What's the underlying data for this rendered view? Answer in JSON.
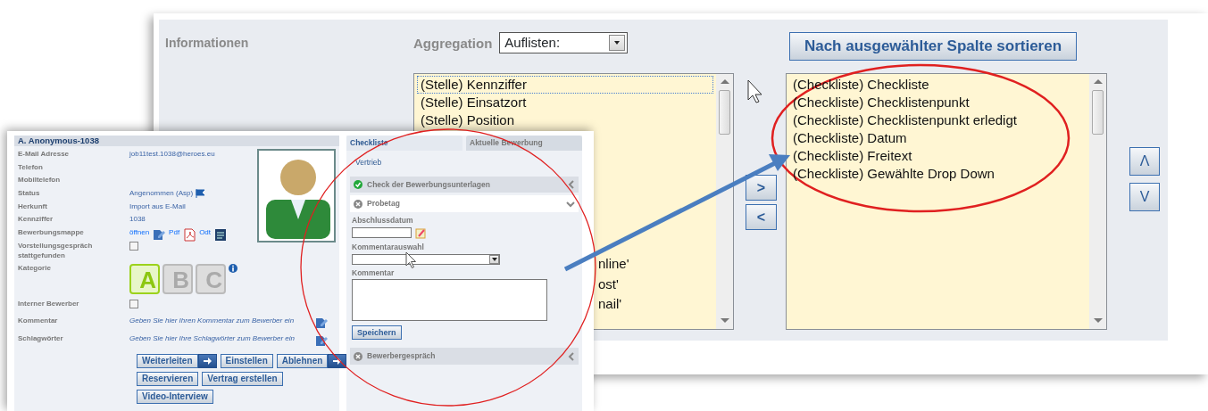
{
  "back_window": {
    "section_title": "Informationen",
    "aggregation": {
      "label": "Aggregation",
      "value": "Auflisten:"
    },
    "available_list": {
      "items": [
        {
          "text": "(Stelle) Kennziffer",
          "focused": true
        },
        {
          "text": "(Stelle) Einsatzort",
          "focused": false
        },
        {
          "text": "(Stelle) Position",
          "focused": false
        }
      ],
      "partial_items": [
        "nline'",
        "ost'",
        "nail'"
      ]
    },
    "move_buttons": [
      ">",
      "<"
    ],
    "sort_button": "Nach ausgewählter Spalte sortieren",
    "selected_list": {
      "items": [
        "(Checkliste) Checkliste",
        "(Checkliste) Checklistenpunkt",
        "(Checkliste) Checklistenpunkt erledigt",
        "(Checkliste) Datum",
        "(Checkliste) Freitext",
        "(Checkliste) Gewählte Drop Down"
      ]
    },
    "order_buttons": [
      "Λ",
      "V"
    ]
  },
  "front_window": {
    "candidate": {
      "name": "A. Anonymous-1038",
      "fields": [
        {
          "kind": "text",
          "label": "E-Mail Adresse",
          "value": "job11test.1038@heroes.eu"
        },
        {
          "kind": "text",
          "label": "Telefon"
        },
        {
          "kind": "text",
          "label": "Mobiltelefon"
        },
        {
          "kind": "status",
          "label": "Status",
          "value": "Angenommen (Asp)"
        },
        {
          "kind": "text",
          "label": "Herkunft",
          "value": "Import aus E-Mail"
        },
        {
          "kind": "text",
          "label": "Kennziffer",
          "value": "1038"
        },
        {
          "kind": "files",
          "label": "Bewerbungsmappe",
          "links": [
            {
              "kind": "open",
              "text": "öffnen"
            },
            {
              "kind": "pdf",
              "text": "Pdf"
            },
            {
              "kind": "odt",
              "text": "Odt"
            }
          ]
        },
        {
          "kind": "checkbox",
          "label": "Vorstellungsgespräch stattgefunden",
          "checked": false
        },
        {
          "kind": "category",
          "label": "Kategorie",
          "options": [
            {
              "letter": "A",
              "selected": true
            },
            {
              "letter": "B",
              "selected": false
            },
            {
              "letter": "C",
              "selected": false
            }
          ]
        },
        {
          "kind": "checkbox",
          "label": "Interner Bewerber",
          "checked": false
        },
        {
          "kind": "prompt",
          "label": "Kommentar",
          "value": "Geben Sie hier Ihren Kommentar zum Bewerber ein"
        },
        {
          "kind": "prompt",
          "label": "Schlagwörter",
          "value": "Geben Sie hier Ihre Schlagwörter zum Bewerber ein"
        }
      ],
      "button_rows": [
        [
          {
            "label": "Weiterleiten",
            "arrow": true
          },
          {
            "label": "Einstellen",
            "arrow": false
          },
          {
            "label": "Ablehnen",
            "arrow": true
          }
        ],
        [
          {
            "label": "Reservieren",
            "arrow": false
          },
          {
            "label": "Vertrag erstellen",
            "arrow": false
          }
        ],
        [
          {
            "label": "Video-Interview",
            "arrow": false
          }
        ]
      ]
    },
    "checklist": {
      "tabs": [
        {
          "label": "Checkliste",
          "selected": true
        },
        {
          "label": "Aktuelle Bewerbung",
          "selected": false
        }
      ],
      "group": "Vertrieb",
      "sections": [
        {
          "title": "Check der Bewerbungsunterlagen",
          "done": true,
          "expanded": false
        },
        {
          "title": "Probetag",
          "done": false,
          "expanded": true,
          "fields": [
            {
              "kind": "date",
              "label": "Abschlussdatum"
            },
            {
              "kind": "select",
              "label": "Kommentarauswahl"
            },
            {
              "kind": "textarea",
              "label": "Kommentar"
            }
          ],
          "save_button": "Speichern"
        },
        {
          "title": "Bewerbergespräch",
          "done": false,
          "expanded": false
        }
      ]
    }
  }
}
